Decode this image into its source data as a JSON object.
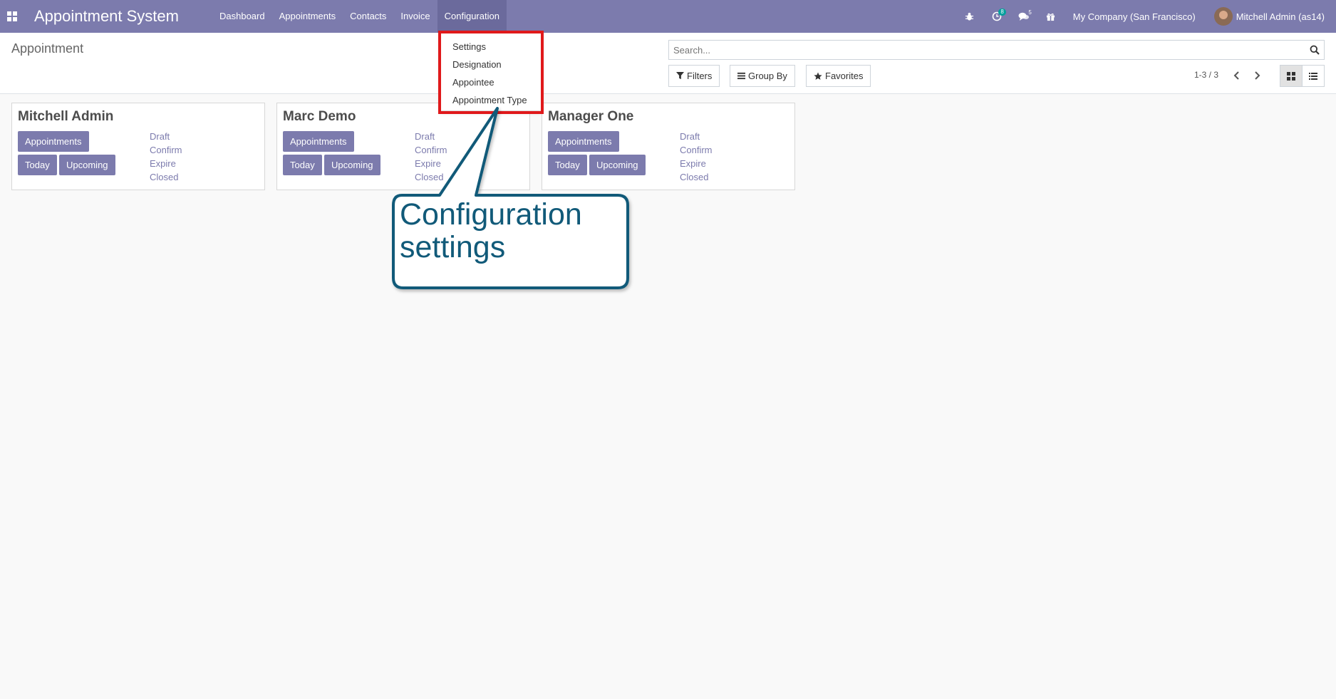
{
  "navbar": {
    "brand": "Appointment System",
    "menu": [
      {
        "label": "Dashboard"
      },
      {
        "label": "Appointments"
      },
      {
        "label": "Contacts"
      },
      {
        "label": "Invoice"
      },
      {
        "label": "Configuration"
      }
    ],
    "activity_count": "8",
    "messages_count": "5",
    "company": "My Company (San Francisco)",
    "user": "Mitchell Admin (as14)"
  },
  "control_panel": {
    "breadcrumb": "Appointment",
    "search_placeholder": "Search...",
    "filters_label": "Filters",
    "groupby_label": "Group By",
    "favorites_label": "Favorites",
    "pager": "1-3 / 3"
  },
  "cards": [
    {
      "name": "Mitchell Admin",
      "appointments": "Appointments",
      "today": "Today",
      "upcoming": "Upcoming",
      "draft": "Draft",
      "confirm": "Confirm",
      "expire": "Expire",
      "closed": "Closed"
    },
    {
      "name": "Marc Demo",
      "appointments": "Appointments",
      "today": "Today",
      "upcoming": "Upcoming",
      "draft": "Draft",
      "confirm": "Confirm",
      "expire": "Expire",
      "closed": "Closed"
    },
    {
      "name": "Manager One",
      "appointments": "Appointments",
      "today": "Today",
      "upcoming": "Upcoming",
      "draft": "Draft",
      "confirm": "Confirm",
      "expire": "Expire",
      "closed": "Closed"
    }
  ],
  "config_dropdown": {
    "items": [
      {
        "label": "Settings"
      },
      {
        "label": "Designation"
      },
      {
        "label": "Appointee"
      },
      {
        "label": "Appointment Type"
      }
    ]
  },
  "annotation": {
    "line1": "Configuration",
    "line2": "settings",
    "highlight_color": "#e0191b",
    "callout_color": "#115a79"
  },
  "colors": {
    "brand": "#7c7bad"
  }
}
